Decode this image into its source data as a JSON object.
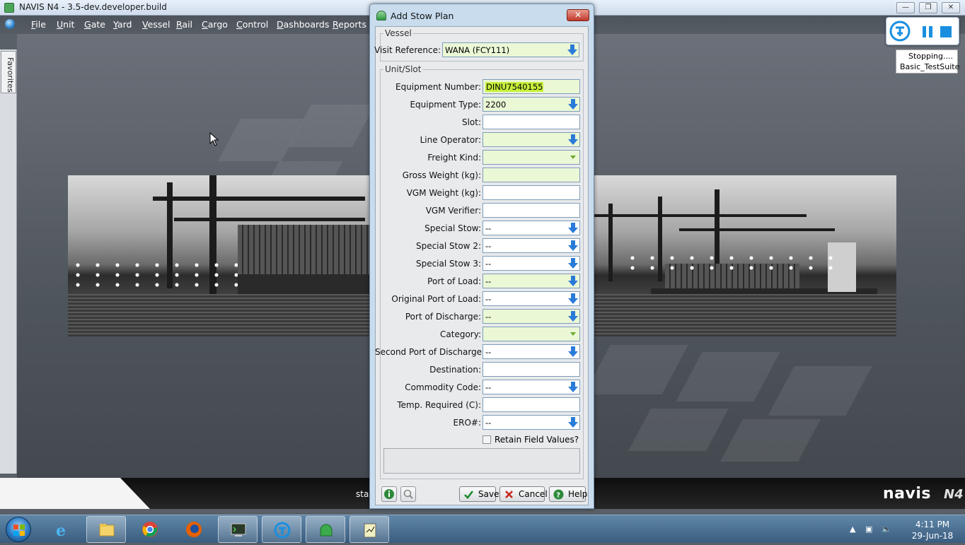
{
  "window": {
    "title": "NAVIS N4 - 3.5-dev.developer.build",
    "minimize_label": "—",
    "restore_label": "❐",
    "close_label": "✕"
  },
  "menu": {
    "items": [
      "File",
      "Unit",
      "Gate",
      "Yard",
      "Vessel",
      "Rail",
      "Cargo",
      "Control",
      "Dashboards",
      "Reports"
    ]
  },
  "favorites": {
    "label": "Favorites"
  },
  "test_widget": {
    "status_line1": "Stopping....",
    "status_line2": "Basic_TestSuite"
  },
  "bottom_strip": {
    "status_text": "star",
    "brand": "navis",
    "brand_suffix": "N4"
  },
  "dialog": {
    "title": "Add Stow Plan",
    "close_label": "✕",
    "vessel_group": {
      "title": "Vessel",
      "visit_reference_label": "Visit Reference:",
      "visit_reference_value": "WANA (FCY111)"
    },
    "unit_group": {
      "title": "Unit/Slot",
      "fields": [
        {
          "label": "Equipment Number:",
          "value": "DINU7540155",
          "kind": "text"
        },
        {
          "label": "Equipment Type:",
          "value": "2200",
          "kind": "lookup"
        },
        {
          "label": "Slot:",
          "value": "",
          "kind": "text"
        },
        {
          "label": "Line Operator:",
          "value": "",
          "kind": "lookup"
        },
        {
          "label": "Freight Kind:",
          "value": "",
          "kind": "combo"
        },
        {
          "label": "Gross Weight (kg):",
          "value": "",
          "kind": "text"
        },
        {
          "label": "VGM Weight (kg):",
          "value": "",
          "kind": "text"
        },
        {
          "label": "VGM Verifier:",
          "value": "",
          "kind": "text"
        },
        {
          "label": "Special Stow:",
          "value": "--",
          "kind": "lookup"
        },
        {
          "label": "Special Stow 2:",
          "value": "--",
          "kind": "lookup"
        },
        {
          "label": "Special Stow 3:",
          "value": "--",
          "kind": "lookup"
        },
        {
          "label": "Port of Load:",
          "value": "--",
          "kind": "lookup"
        },
        {
          "label": "Original Port of Load:",
          "value": "--",
          "kind": "lookup"
        },
        {
          "label": "Port of Discharge:",
          "value": "--",
          "kind": "lookup"
        },
        {
          "label": "Category:",
          "value": "",
          "kind": "combo"
        },
        {
          "label": "Second Port of Discharge:",
          "value": "--",
          "kind": "lookup"
        },
        {
          "label": "Destination:",
          "value": "",
          "kind": "text"
        },
        {
          "label": "Commodity Code:",
          "value": "--",
          "kind": "lookup"
        },
        {
          "label": "Temp. Required (C):",
          "value": "",
          "kind": "text"
        },
        {
          "label": "ERO#:",
          "value": "--",
          "kind": "lookup"
        }
      ]
    },
    "retain_label": "Retain Field Values?",
    "retain_checked": false,
    "buttons": {
      "save": "Save",
      "cancel": "Cancel",
      "help": "Help"
    },
    "colors": {
      "required_field": "#ebf8d6",
      "highlight": "#c6f03a",
      "lookup_arrow": "#2a7bd8"
    }
  },
  "taskbar": {
    "time": "4:11 PM",
    "date": "29-Jun-18",
    "apps": [
      "internet-explorer",
      "file-explorer",
      "chrome",
      "firefox",
      "terminal",
      "test-runner",
      "navis-n4",
      "notepad"
    ]
  }
}
